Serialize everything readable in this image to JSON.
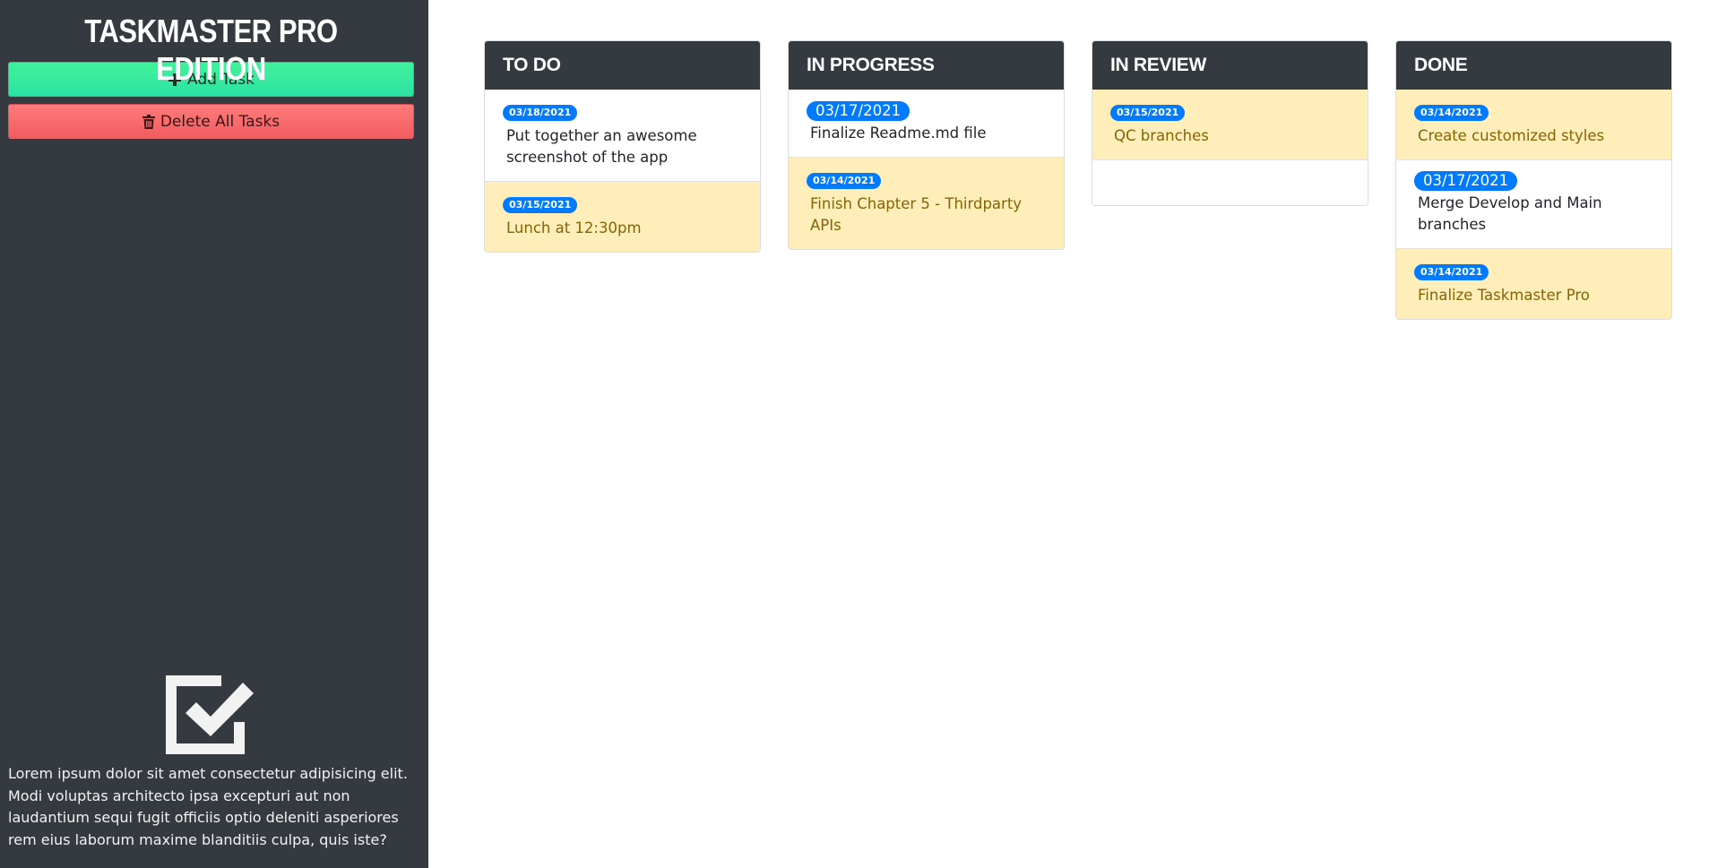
{
  "app": {
    "title": "TASKMASTER PRO EDITION"
  },
  "sidebar": {
    "add_label": "Add Task",
    "delete_label": "Delete All Tasks",
    "description": "Lorem ipsum dolor sit amet consectetur adipisicing elit. Modi voluptas architecto ipsa excepturi aut non laudantium sequi fugit officiis optio deleniti asperiores rem eius laborum maxime blanditiis culpa, quis iste?"
  },
  "colors": {
    "sidebar_bg": "#343a40",
    "badge_blue": "#007bff",
    "warning_bg": "#ffeeba",
    "warning_text": "#856404",
    "add_green": "#2ce2a4",
    "delete_red": "#f25c60"
  },
  "columns": [
    {
      "title": "TO DO",
      "tasks": [
        {
          "date": "03/18/2021",
          "text": "Put together an awesome screenshot of the app",
          "status": "normal"
        },
        {
          "date": "03/15/2021",
          "text": "Lunch at 12:30pm",
          "status": "warning"
        }
      ]
    },
    {
      "title": "IN PROGRESS",
      "tasks": [
        {
          "date": "03/17/2021",
          "text": "Finalize Readme.md file",
          "status": "normal"
        },
        {
          "date": "03/14/2021",
          "text": "Finish Chapter 5 - Thirdparty APIs",
          "status": "warning"
        }
      ]
    },
    {
      "title": "IN REVIEW",
      "tasks": [
        {
          "date": "03/15/2021",
          "text": "QC branches",
          "status": "warning"
        }
      ]
    },
    {
      "title": "DONE",
      "tasks": [
        {
          "date": "03/14/2021",
          "text": "Create customized styles",
          "status": "warning"
        },
        {
          "date": "03/17/2021",
          "text": "Merge Develop and Main branches",
          "status": "normal"
        },
        {
          "date": "03/14/2021",
          "text": "Finalize Taskmaster Pro",
          "status": "warning"
        }
      ]
    }
  ]
}
